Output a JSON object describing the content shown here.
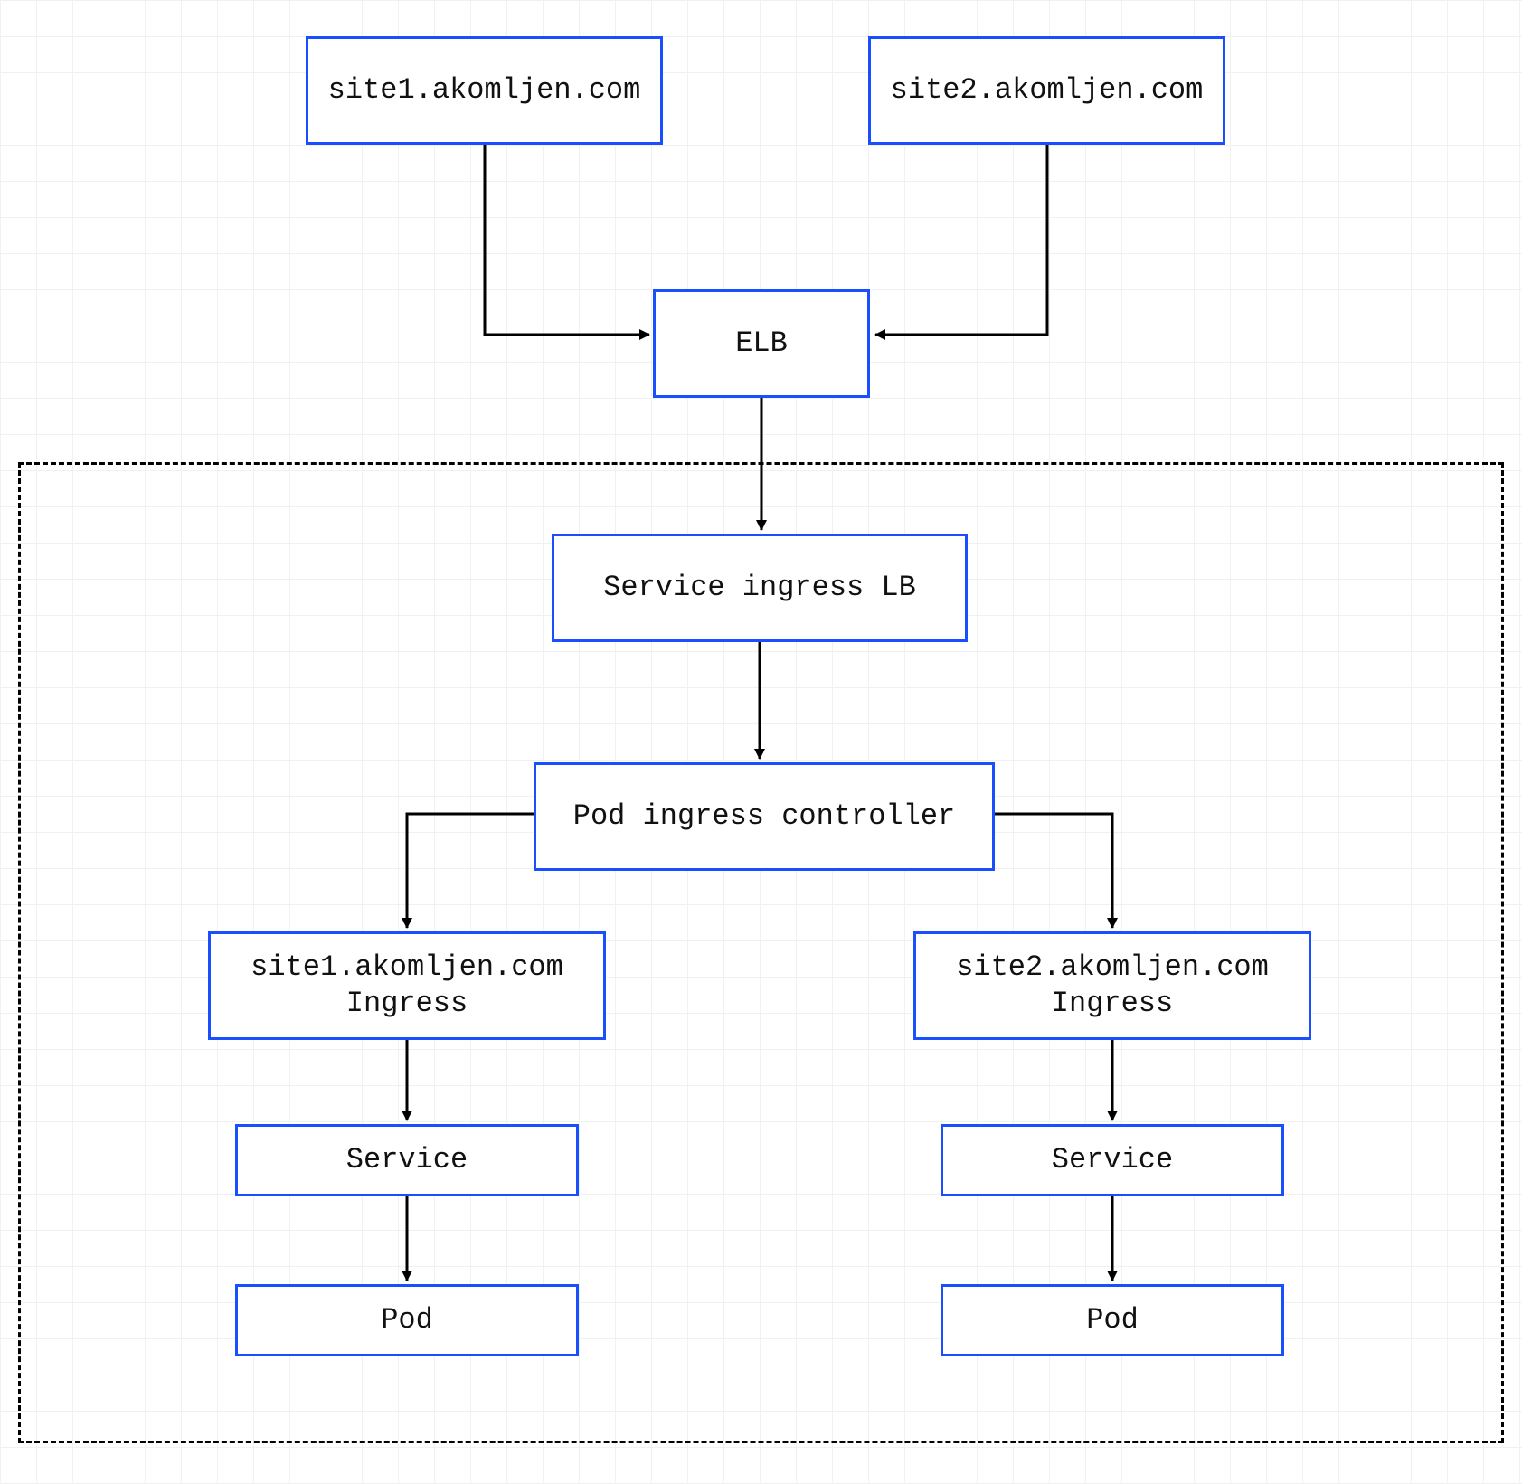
{
  "nodes": {
    "site1_top": {
      "label": "site1.akomljen.com"
    },
    "site2_top": {
      "label": "site2.akomljen.com"
    },
    "elb": {
      "label": "ELB"
    },
    "svc_ingress_lb": {
      "label": "Service ingress LB"
    },
    "pod_ingress_ctrl": {
      "label": "Pod ingress controller"
    },
    "ingress1": {
      "label": "site1.akomljen.com\nIngress"
    },
    "ingress2": {
      "label": "site2.akomljen.com\nIngress"
    },
    "service1": {
      "label": "Service"
    },
    "service2": {
      "label": "Service"
    },
    "pod1": {
      "label": "Pod"
    },
    "pod2": {
      "label": "Pod"
    }
  },
  "colors": {
    "node_border": "#1a4fff",
    "arrow": "#000000",
    "grid": "#f1f1f1",
    "cluster_border": "#000000"
  }
}
